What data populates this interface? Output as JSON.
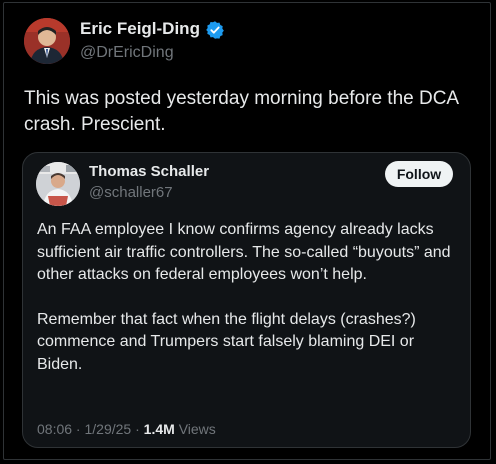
{
  "post": {
    "author_name": "Eric Feigl-Ding",
    "author_handle": "@DrEricDing",
    "text": "This was posted yesterday morning before the DCA crash. Prescient."
  },
  "quoted_post": {
    "author_name": "Thomas Schaller",
    "author_handle": "@schaller67",
    "follow_label": "Follow",
    "paragraphs": [
      "An FAA employee I know confirms agency already lacks sufficient air traffic controllers. The so-called “buyouts” and other attacks on federal employees won’t help.",
      "Remember that fact when the flight delays (crashes?) commence and Trumpers start falsely blaming DEI or Biden."
    ],
    "time": "08:06",
    "date": "1/29/25",
    "views_count": "1.4M",
    "views_label": "Views"
  },
  "icons": {
    "verified": "verified-badge-icon",
    "author_avatar": "avatar",
    "quoted_avatar": "avatar"
  },
  "colors": {
    "background": "#000000",
    "text": "#e7e9ea",
    "secondary_text": "#71767b",
    "verified": "#1d9bf0",
    "border": "#2f3336",
    "follow_button_bg": "#eff3f4"
  }
}
